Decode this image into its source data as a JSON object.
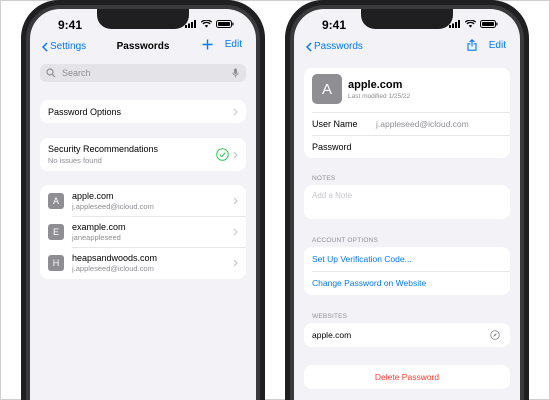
{
  "left": {
    "status_time": "9:41",
    "nav": {
      "back_label": "Settings",
      "title": "Passwords",
      "edit_label": "Edit"
    },
    "search": {
      "placeholder": "Search"
    },
    "password_options": "Password Options",
    "security": {
      "title": "Security Recommendations",
      "subtitle": "No issues found"
    },
    "accounts": [
      {
        "initial": "A",
        "site": "apple.com",
        "user": "j.appleseed@icloud.com"
      },
      {
        "initial": "E",
        "site": "example.com",
        "user": "janeappleseed"
      },
      {
        "initial": "H",
        "site": "heapsandwoods.com",
        "user": "j.appleseed@icloud.com"
      }
    ]
  },
  "right": {
    "status_time": "9:41",
    "nav": {
      "back_label": "Passwords",
      "edit_label": "Edit"
    },
    "header": {
      "initial": "A",
      "site": "apple.com",
      "modified": "Last modified 1/25/22"
    },
    "fields": {
      "user_label": "User Name",
      "user_value": "j.appleseed@icloud.com",
      "password_label": "Password"
    },
    "notes": {
      "header": "NOTES",
      "placeholder": "Add a Note"
    },
    "account_options": {
      "header": "ACCOUNT OPTIONS",
      "verification": "Set Up Verification Code...",
      "change_password": "Change Password on Website"
    },
    "websites": {
      "header": "WEBSITES",
      "site": "apple.com"
    },
    "delete_label": "Delete Password"
  },
  "colors": {
    "accent": "#007aff",
    "destructive": "#ff3b30",
    "success": "#34c759",
    "background": "#f2f2f7"
  }
}
